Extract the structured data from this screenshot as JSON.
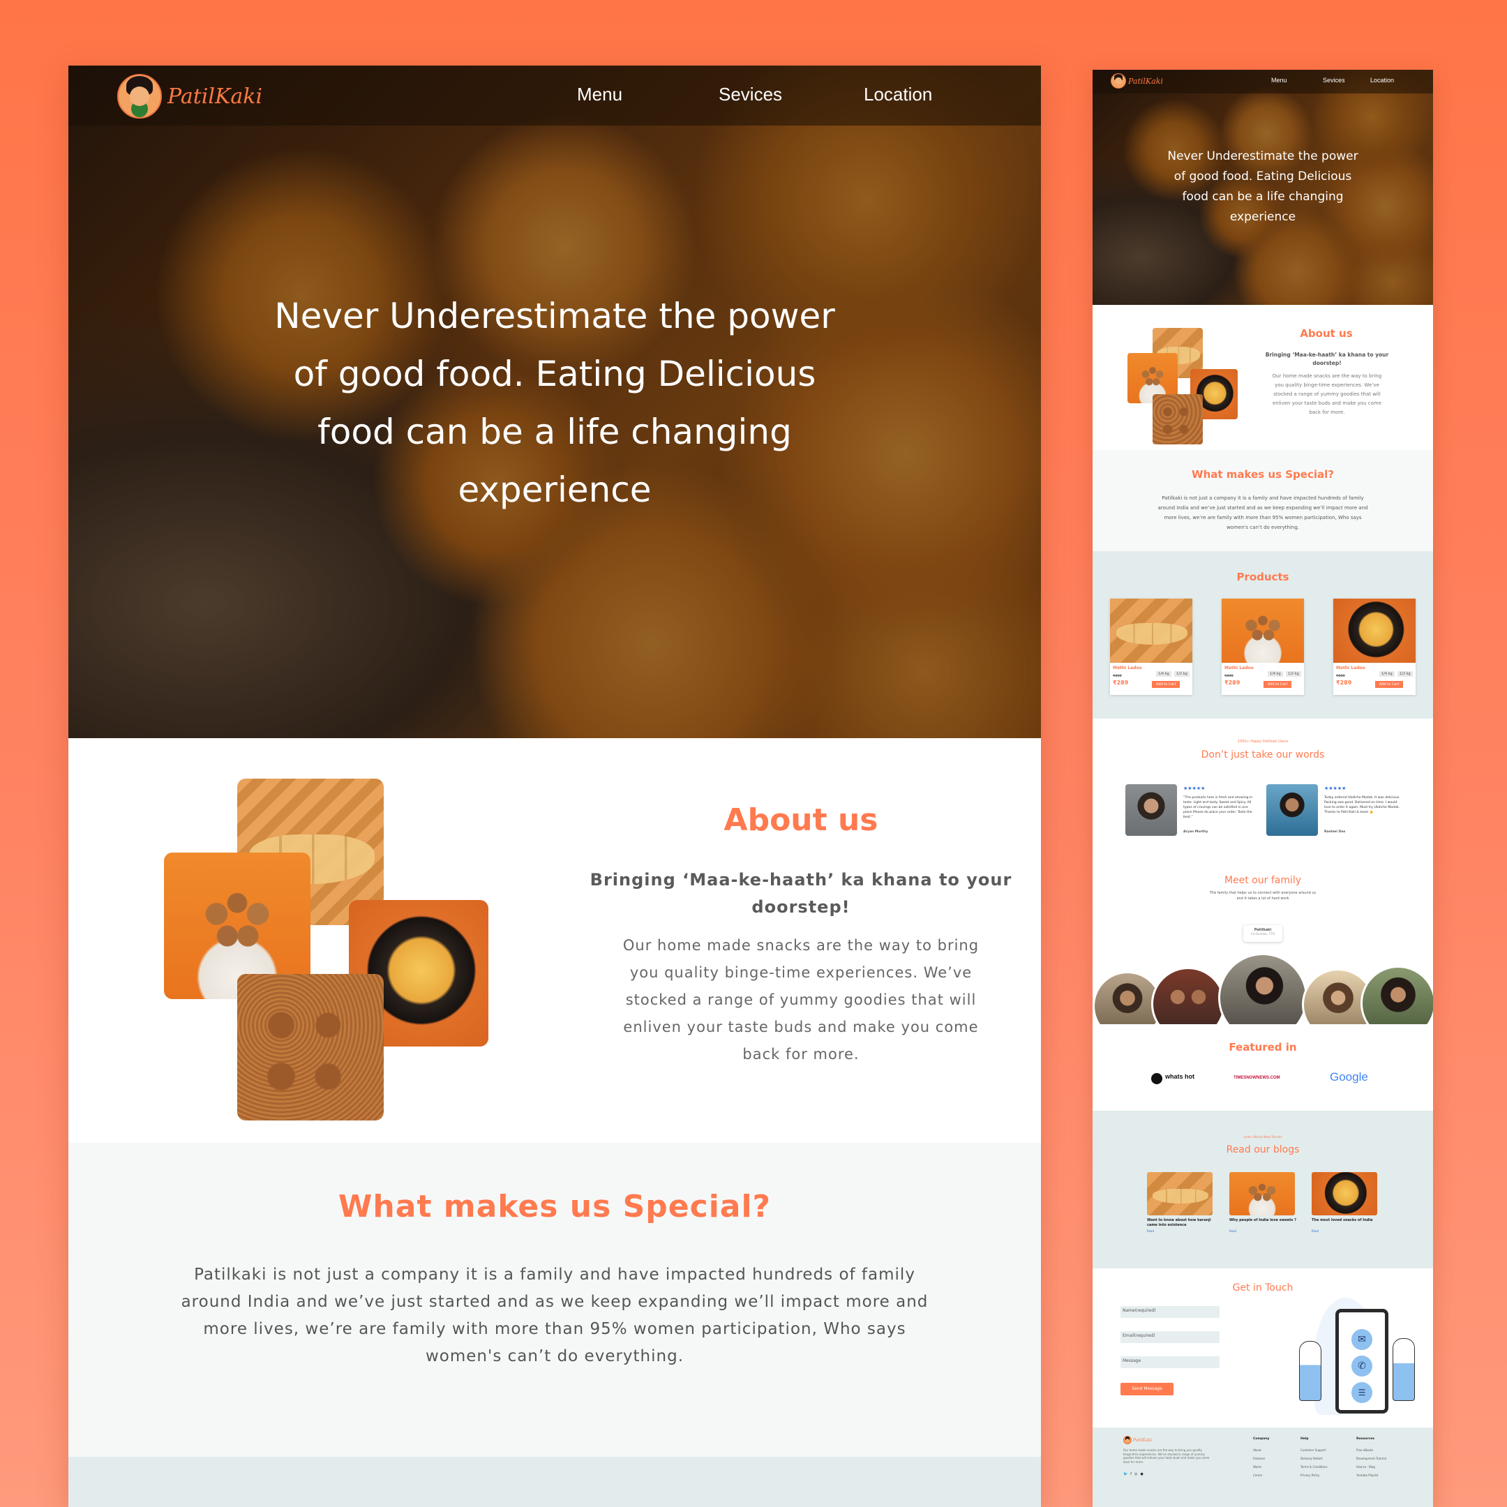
{
  "brand": {
    "name": "PatilKaki",
    "accent": "#ff7a4f"
  },
  "nav": {
    "menu": "Menu",
    "services": "Sevices",
    "location": "Location"
  },
  "hero": {
    "line1": "Never Underestimate the power",
    "line2": "of good food. Eating Delicious",
    "line3": "food can be a life changing",
    "line4": "experience"
  },
  "about": {
    "title": "About us",
    "subtitle1": "Bringing ‘Maa-ke-haath’ ka khana to your",
    "subtitle2": "doorstep!",
    "body1": "Our home made snacks are the way to bring",
    "body2": "you quality binge-time experiences. We’ve",
    "body3": "stocked a range of yummy goodies that will",
    "body4": "enliven your taste buds and make you come",
    "body5": "back for more."
  },
  "special": {
    "title": "What makes us Special?",
    "body1": "Patilkaki is not just a company it is a family and have impacted hundreds of family",
    "body2": "around India and we’ve just started and as we keep expanding we’ll impact more and",
    "body3": "more lives, we’re are family with more than 95% women participation, Who says",
    "body4": "women's can’t do everything."
  },
  "products": {
    "title": "Products",
    "items": [
      {
        "name": "Methi Ladoo",
        "old_price": "₹399",
        "price": "₹289",
        "w1": "1/4 kg",
        "w2": "1/2 kg",
        "cta": "Add to Cart"
      },
      {
        "name": "Methi Ladoo",
        "old_price": "₹399",
        "price": "₹289",
        "w1": "1/4 kg",
        "w2": "1/2 kg",
        "cta": "Add to Cart"
      },
      {
        "name": "Methi Ladoo",
        "old_price": "₹399",
        "price": "₹289",
        "w1": "1/4 kg",
        "w2": "1/2 kg",
        "cta": "Add to Cart"
      }
    ]
  },
  "testimonials": {
    "eyebrow": "1000+ Happy Patilkaki Users",
    "title": "Don’t just take our words",
    "items": [
      {
        "stars": "★★★★★",
        "quote": "“The products here is fresh and amazing in taste. Light and tasty. Sweet and Spicy. All types of cravings can be satisfied in one place.Please do place your order. Taste the best.”",
        "author": "Aryan Murthy"
      },
      {
        "stars": "★★★★★",
        "quote": "Today ordered Ukdiche Modak. It was delicious. Packing was good. Delivered on time. I would love to order it again. Must try Ukdiche Modak. Thanks to Patil Kaki & team 👍",
        "author": "Rashmi Das"
      }
    ]
  },
  "family": {
    "title": "Meet our family",
    "subtitle1": "The family that helps us to connect with everyone around us",
    "subtitle2": "and it takes a lot of hard work",
    "badge_name": "Patilkaki",
    "badge_role": "Co-Founder, CTO"
  },
  "featured": {
    "title": "Featured in",
    "logo1": "whats hot",
    "logo2": "TIMESNOWNEWS.COM",
    "logo3": "Google"
  },
  "blogs": {
    "eyebrow": "Learn About New Stories",
    "title": "Read our blogs",
    "items": [
      {
        "title": "Want to know about how karanji came into existence",
        "link": "Read"
      },
      {
        "title": "Why people of India love sweets ?",
        "link": "Read"
      },
      {
        "title": "The most loved snacks of India",
        "link": "Read"
      }
    ]
  },
  "contact": {
    "title": "Get in Touch",
    "name_ph": "Name(required)",
    "email_ph": "Email(required)",
    "message_ph": "Message",
    "submit": "Send Message"
  },
  "footer": {
    "about": "Our home made snacks are the way to bring you quality binge-time experiences. We’ve stocked a range of yummy goodies that will enliven your taste buds and make you come back for more.",
    "col1_title": "Company",
    "col1": [
      "About",
      "Features",
      "Works",
      "Career"
    ],
    "col2_title": "Help",
    "col2": [
      "Customer Support",
      "Delivery Details",
      "Terms & Conditions",
      "Privacy Policy"
    ],
    "col3_title": "Resources",
    "col3": [
      "Free eBooks",
      "Development Tutorial",
      "How to - Blog",
      "Youtube Playlist"
    ]
  }
}
